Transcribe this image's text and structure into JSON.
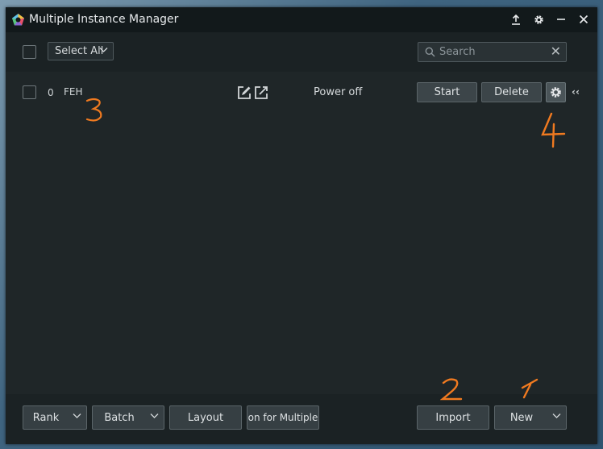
{
  "window": {
    "title": "Multiple Instance Manager"
  },
  "titlebar": {
    "icons": [
      "upload-icon",
      "gear-icon",
      "minimize-icon",
      "close-icon"
    ]
  },
  "toolbar": {
    "select_all_label": "Select All",
    "search_placeholder": "Search"
  },
  "instances": [
    {
      "index": "0",
      "name": "FEH",
      "status": "Power off",
      "start_label": "Start",
      "delete_label": "Delete"
    }
  ],
  "footer": {
    "rank_label": "Rank",
    "batch_label": "Batch",
    "layout_label": "Layout",
    "multi_label": "on for Multiple",
    "import_label": "Import",
    "new_label": "New"
  },
  "annotations": [
    "1",
    "2",
    "3",
    "4"
  ],
  "colors": {
    "annotation": "#f07a20",
    "window_bg": "#1f2628",
    "titlebar_bg": "#12191b"
  }
}
